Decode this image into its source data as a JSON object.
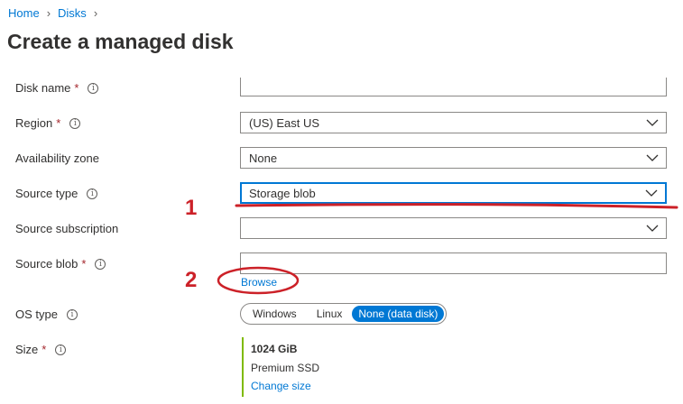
{
  "breadcrumb": {
    "items": [
      "Home",
      "Disks"
    ],
    "separator_icon": "chevron-right-icon"
  },
  "page": {
    "title": "Create a managed disk"
  },
  "form": {
    "disk_name": {
      "label": "Disk name",
      "required": true,
      "value": ""
    },
    "region": {
      "label": "Region",
      "required": true,
      "value": "(US) East US"
    },
    "availability_zone": {
      "label": "Availability zone",
      "value": "None"
    },
    "source_type": {
      "label": "Source type",
      "value": "Storage blob"
    },
    "source_subscription": {
      "label": "Source subscription",
      "value": ""
    },
    "source_blob": {
      "label": "Source blob",
      "required": true,
      "value": "",
      "browse_label": "Browse"
    },
    "os_type": {
      "label": "OS type",
      "options": [
        "Windows",
        "Linux",
        "None (data disk)"
      ],
      "selected": "None (data disk)"
    },
    "size": {
      "label": "Size",
      "required": true,
      "value": "1024 GiB",
      "tier": "Premium SSD",
      "change_label": "Change size"
    },
    "required_marker": "*"
  },
  "annotations": {
    "one": "1",
    "two": "2",
    "color": "#cc2128"
  },
  "colors": {
    "accent": "#0078d4",
    "required": "#a4262c",
    "size_bar": "#7fba00"
  }
}
